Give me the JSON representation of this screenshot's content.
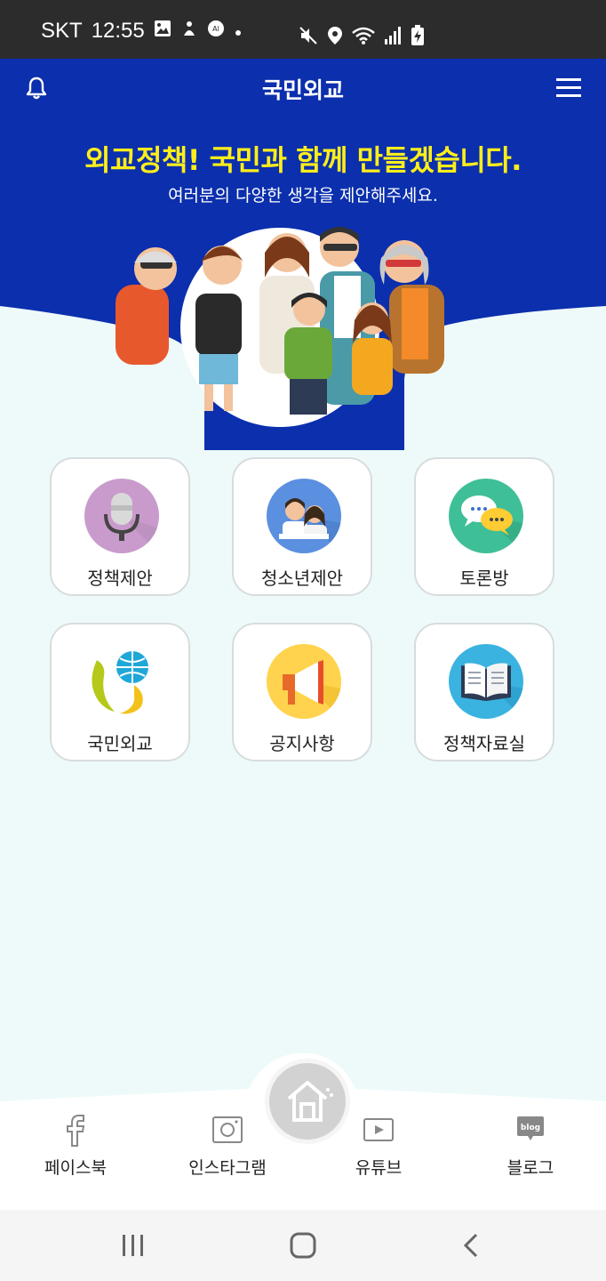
{
  "status_bar": {
    "carrier": "SKT",
    "time": "12:55"
  },
  "app_bar": {
    "title": "국민외교",
    "icons": {
      "left": "bell-icon",
      "right": "hamburger-menu-icon"
    }
  },
  "hero": {
    "headline": "외교정책! 국민과 함께 만들겠습니다.",
    "subline": "여러분의 다양한 생각을 제안해주세요."
  },
  "menu_tiles": [
    {
      "label": "정책제안",
      "icon": "microphone-icon",
      "color": "#c99bcc"
    },
    {
      "label": "청소년제안",
      "icon": "students-icon",
      "color": "#5b8fe0"
    },
    {
      "label": "토론방",
      "icon": "chat-bubbles-icon",
      "color": "#3fbf97"
    },
    {
      "label": "국민외교",
      "icon": "globe-people-logo-icon",
      "color": "#ffffff"
    },
    {
      "label": "공지사항",
      "icon": "megaphone-icon",
      "color": "#ffd34d"
    },
    {
      "label": "정책자료실",
      "icon": "book-icon",
      "color": "#3ab3e0"
    }
  ],
  "bottom_bar": {
    "home_icon": "home-icon",
    "items": [
      {
        "label": "페이스북",
        "icon": "facebook-icon"
      },
      {
        "label": "인스타그램",
        "icon": "instagram-icon"
      },
      {
        "label": "유튜브",
        "icon": "youtube-icon"
      },
      {
        "label": "블로그",
        "icon": "blog-icon",
        "icon_text": "blog"
      }
    ]
  },
  "colors": {
    "header_blue": "#0b2fad",
    "headline_yellow": "#ffee1a",
    "background": "#eefafa"
  }
}
